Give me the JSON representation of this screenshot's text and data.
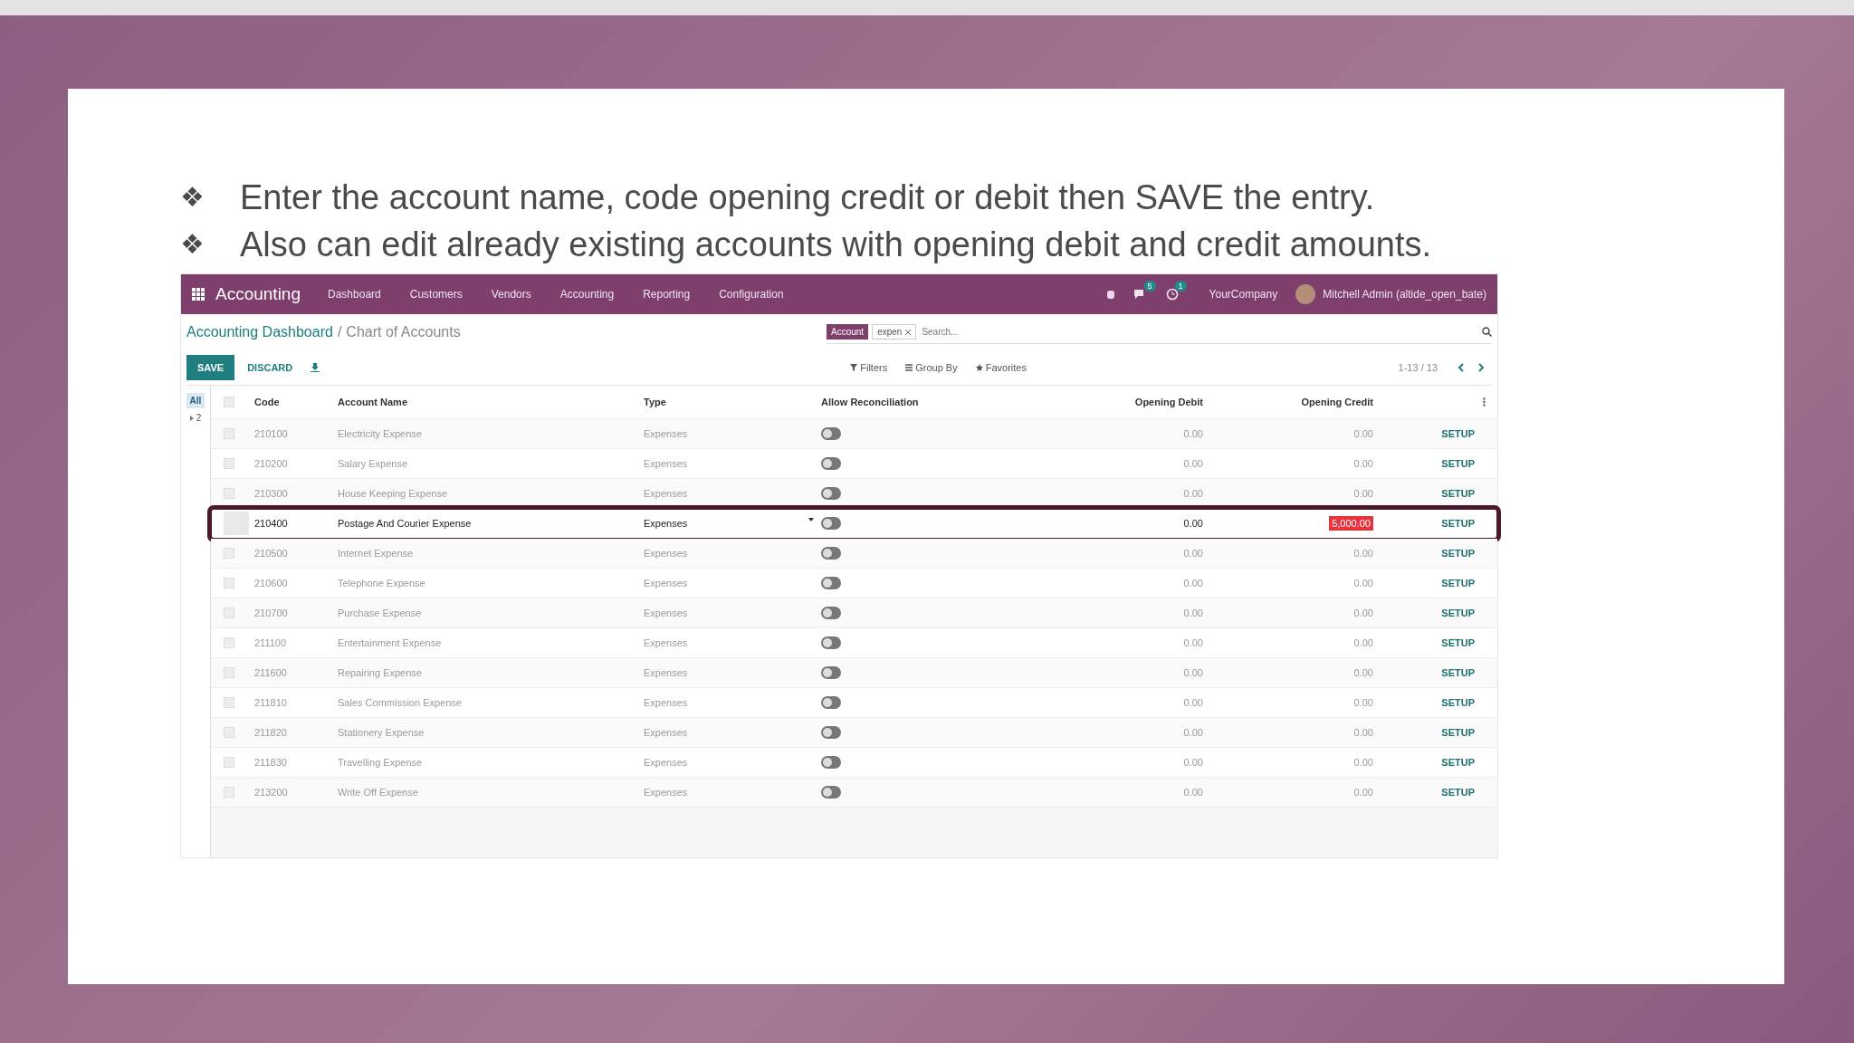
{
  "slide": {
    "bullets": [
      {
        "marker": "❖",
        "text": "Enter the account name, code opening credit or debit then SAVE the entry."
      },
      {
        "marker": "❖",
        "text": "Also can edit already existing accounts with opening debit and credit amounts."
      }
    ]
  },
  "app": {
    "navbar": {
      "app_name": "Accounting",
      "menu": [
        "Dashboard",
        "Customers",
        "Vendors",
        "Accounting",
        "Reporting",
        "Configuration"
      ],
      "chat_badge": "5",
      "activity_badge": "1",
      "company": "YourCompany",
      "user": "Mitchell Admin (altide_open_bate)"
    },
    "breadcrumb": {
      "parent": "Accounting Dashboard",
      "separator": "/",
      "current": "Chart of Accounts"
    },
    "search": {
      "facet_label": "Account",
      "facet_value": "expen",
      "placeholder": "Search..."
    },
    "buttons": {
      "save": "SAVE",
      "discard": "DISCARD"
    },
    "filters": [
      "Filters",
      "Group By",
      "Favorites"
    ],
    "pager": "1-13 / 13",
    "side_panel": [
      {
        "kind": "all",
        "label": "All",
        "selected": true
      },
      {
        "kind": "group",
        "label": "2",
        "selected": false
      }
    ],
    "select_all": {
      "checked": false
    },
    "columns": [
      "Code",
      "Account Name",
      "Type",
      "Allow Reconciliation",
      "Opening Debit",
      "Opening Credit"
    ],
    "rows": [
      {
        "code": "210100",
        "name": "Electricity Expense",
        "type": "Expenses",
        "reconcile": false,
        "debit": "0.00",
        "credit": "0.00",
        "action": "SETUP",
        "editing": false
      },
      {
        "code": "210200",
        "name": "Salary Expense",
        "type": "Expenses",
        "reconcile": false,
        "debit": "0.00",
        "credit": "0.00",
        "action": "SETUP",
        "editing": false
      },
      {
        "code": "210300",
        "name": "House Keeping Expense",
        "type": "Expenses",
        "reconcile": false,
        "debit": "0.00",
        "credit": "0.00",
        "action": "SETUP",
        "editing": false
      },
      {
        "code": "210400",
        "name": "Postage And Courier Expense",
        "type": "Expenses",
        "reconcile": false,
        "debit": "0.00",
        "credit": "5,000.00",
        "action": "SETUP",
        "editing": true
      },
      {
        "code": "210500",
        "name": "Internet Expense",
        "type": "Expenses",
        "reconcile": false,
        "debit": "0.00",
        "credit": "0.00",
        "action": "SETUP",
        "editing": false
      },
      {
        "code": "210600",
        "name": "Telephone Expense",
        "type": "Expenses",
        "reconcile": false,
        "debit": "0.00",
        "credit": "0.00",
        "action": "SETUP",
        "editing": false
      },
      {
        "code": "210700",
        "name": "Purchase Expense",
        "type": "Expenses",
        "reconcile": false,
        "debit": "0.00",
        "credit": "0.00",
        "action": "SETUP",
        "editing": false
      },
      {
        "code": "211100",
        "name": "Entertainment Expense",
        "type": "Expenses",
        "reconcile": false,
        "debit": "0.00",
        "credit": "0.00",
        "action": "SETUP",
        "editing": false
      },
      {
        "code": "211600",
        "name": "Repairing Expense",
        "type": "Expenses",
        "reconcile": false,
        "debit": "0.00",
        "credit": "0.00",
        "action": "SETUP",
        "editing": false
      },
      {
        "code": "211810",
        "name": "Sales Commission Expense",
        "type": "Expenses",
        "reconcile": false,
        "debit": "0.00",
        "credit": "0.00",
        "action": "SETUP",
        "editing": false
      },
      {
        "code": "211820",
        "name": "Stationery Expense",
        "type": "Expenses",
        "reconcile": false,
        "debit": "0.00",
        "credit": "0.00",
        "action": "SETUP",
        "editing": false
      },
      {
        "code": "211830",
        "name": "Travelling Expense",
        "type": "Expenses",
        "reconcile": false,
        "debit": "0.00",
        "credit": "0.00",
        "action": "SETUP",
        "editing": false
      },
      {
        "code": "213200",
        "name": "Write Off Expense",
        "type": "Expenses",
        "reconcile": false,
        "debit": "0.00",
        "credit": "0.00",
        "action": "SETUP",
        "editing": false
      }
    ]
  }
}
